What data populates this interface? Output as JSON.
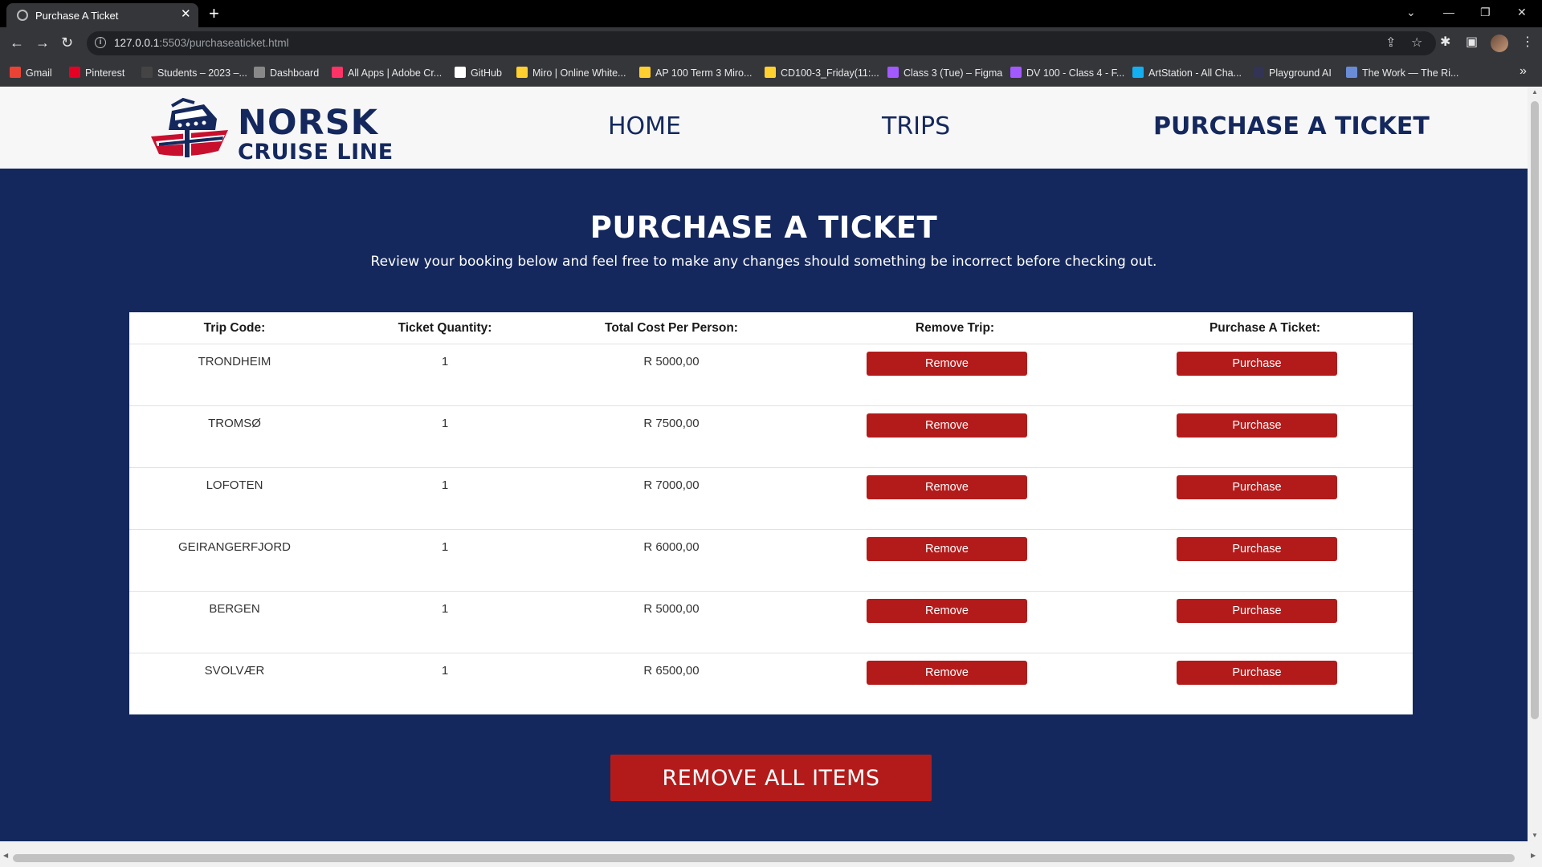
{
  "browser": {
    "tab_title": "Purchase A Ticket",
    "tab_close": "✕",
    "new_tab": "+",
    "url_host": "127.0.0.1",
    "url_path": ":5503/purchaseaticket.html",
    "bookmarks": [
      {
        "label": "Gmail",
        "color": "#ea4335"
      },
      {
        "label": "Pinterest",
        "color": "#e60023"
      },
      {
        "label": "Students – 2023 –...",
        "color": "#444444"
      },
      {
        "label": "Dashboard",
        "color": "#888888"
      },
      {
        "label": "All Apps | Adobe Cr...",
        "color": "#ff3366"
      },
      {
        "label": "GitHub",
        "color": "#ffffff"
      },
      {
        "label": "Miro | Online White...",
        "color": "#ffd02f"
      },
      {
        "label": "AP 100 Term 3 Miro...",
        "color": "#ffd02f"
      },
      {
        "label": "CD100-3_Friday(11:...",
        "color": "#ffd02f"
      },
      {
        "label": "Class 3 (Tue) – Figma",
        "color": "#a259ff"
      },
      {
        "label": "DV 100 - Class 4 - F...",
        "color": "#a259ff"
      },
      {
        "label": "ArtStation - All Cha...",
        "color": "#13aff0"
      },
      {
        "label": "Playground AI",
        "color": "#333355"
      },
      {
        "label": "The Work — The Ri...",
        "color": "#6a8cd6"
      }
    ]
  },
  "site": {
    "logo_line1": "NORSK",
    "logo_line2": "CRUISE LINE",
    "nav": {
      "home": "HOME",
      "trips": "TRIPS",
      "purchase": "PURCHASE A TICKET"
    },
    "page_title": "PURCHASE A TICKET",
    "page_subtitle": "Review your booking below and feel free to make any changes should something be incorrect before checking out.",
    "table": {
      "headers": {
        "trip_code": "Trip Code:",
        "quantity": "Ticket Quantity:",
        "cost": "Total Cost Per Person:",
        "remove": "Remove Trip:",
        "purchase": "Purchase A Ticket:"
      },
      "rows": [
        {
          "trip": "TRONDHEIM",
          "qty": "1",
          "cost": "R 5000,00",
          "remove": "Remove",
          "purchase": "Purchase"
        },
        {
          "trip": "TROMSØ",
          "qty": "1",
          "cost": "R 7500,00",
          "remove": "Remove",
          "purchase": "Purchase"
        },
        {
          "trip": "LOFOTEN",
          "qty": "1",
          "cost": "R 7000,00",
          "remove": "Remove",
          "purchase": "Purchase"
        },
        {
          "trip": "GEIRANGERFJORD",
          "qty": "1",
          "cost": "R 6000,00",
          "remove": "Remove",
          "purchase": "Purchase"
        },
        {
          "trip": "BERGEN",
          "qty": "1",
          "cost": "R 5000,00",
          "remove": "Remove",
          "purchase": "Purchase"
        },
        {
          "trip": "SVOLVÆR",
          "qty": "1",
          "cost": "R 6500,00",
          "remove": "Remove",
          "purchase": "Purchase"
        }
      ]
    },
    "remove_all": "REMOVE ALL ITEMS"
  },
  "colors": {
    "navy": "#14285d",
    "red": "#b31b1b",
    "header_bg": "#f7f7f8"
  }
}
